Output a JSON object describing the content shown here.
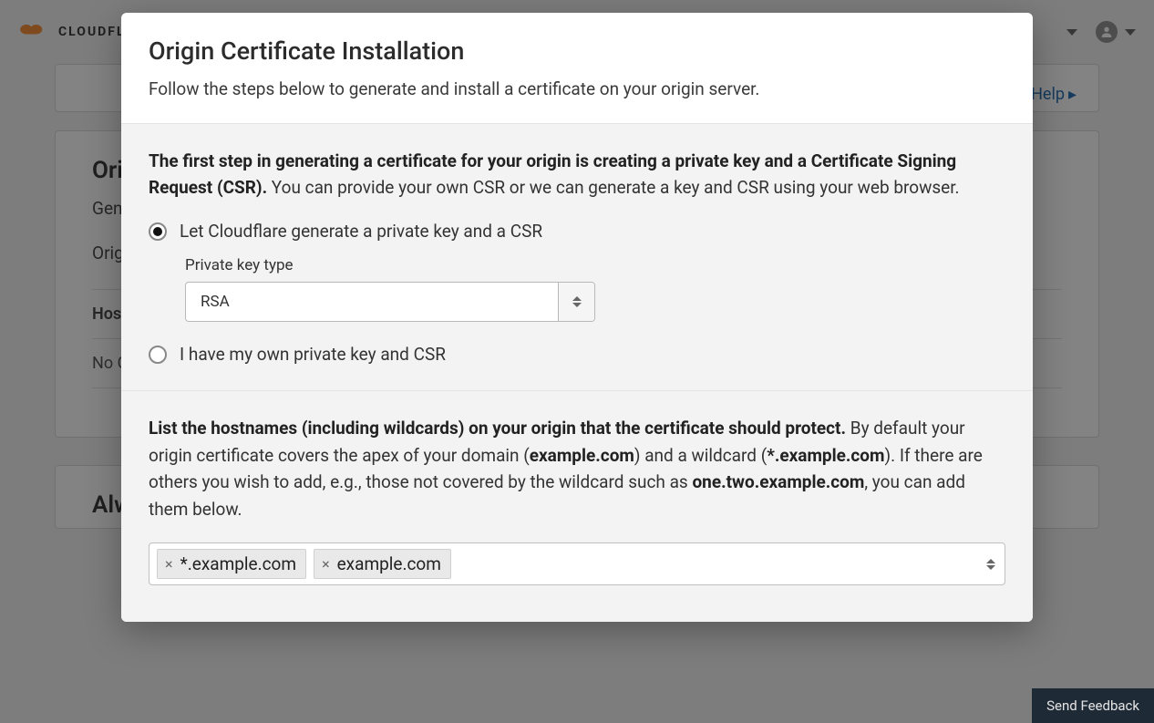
{
  "header": {
    "brand": "CLOUDFLARE",
    "help_label": "Help"
  },
  "bg": {
    "card1": {
      "title": "Origin Certificates",
      "line1": "Generate a free TLS certificate signed by Cloudflare to install on your origin server.",
      "line2": "Origin Certificates are only valid for encryption between Cloudflare and your origin server."
    },
    "hosts_label": "Hosts",
    "no_cert": "No Certificates.",
    "pager_prev": "‹",
    "pager_next": "›",
    "card2_title": "Always Use HTTPS"
  },
  "modal": {
    "title": "Origin Certificate Installation",
    "subtitle": "Follow the steps below to generate and install a certificate on your origin server.",
    "step1": {
      "bold": "The first step in generating a certificate for your origin is creating a private key and a Certificate Signing Request (CSR).",
      "rest": " You can provide your own CSR or we can generate a key and CSR using your web browser.",
      "radio_generate_label": "Let Cloudflare generate a private key and a CSR",
      "radio_own_label": "I have my own private key and CSR",
      "key_type_label": "Private key type",
      "key_type_value": "RSA"
    },
    "step2": {
      "bold": "List the hostnames (including wildcards) on your origin that the certificate should protect.",
      "part_a": " By default your origin certificate covers the apex of your domain (",
      "apex": "example.com",
      "part_b": ") and a wildcard (",
      "wild": "*.example.com",
      "part_c": "). If there are others you wish to add, e.g., those not covered by the wildcard such as ",
      "sub": "one.two.example.com",
      "part_d": ", you can add them below.",
      "tags": [
        "*.example.com",
        "example.com"
      ]
    }
  },
  "feedback_label": "Send Feedback"
}
